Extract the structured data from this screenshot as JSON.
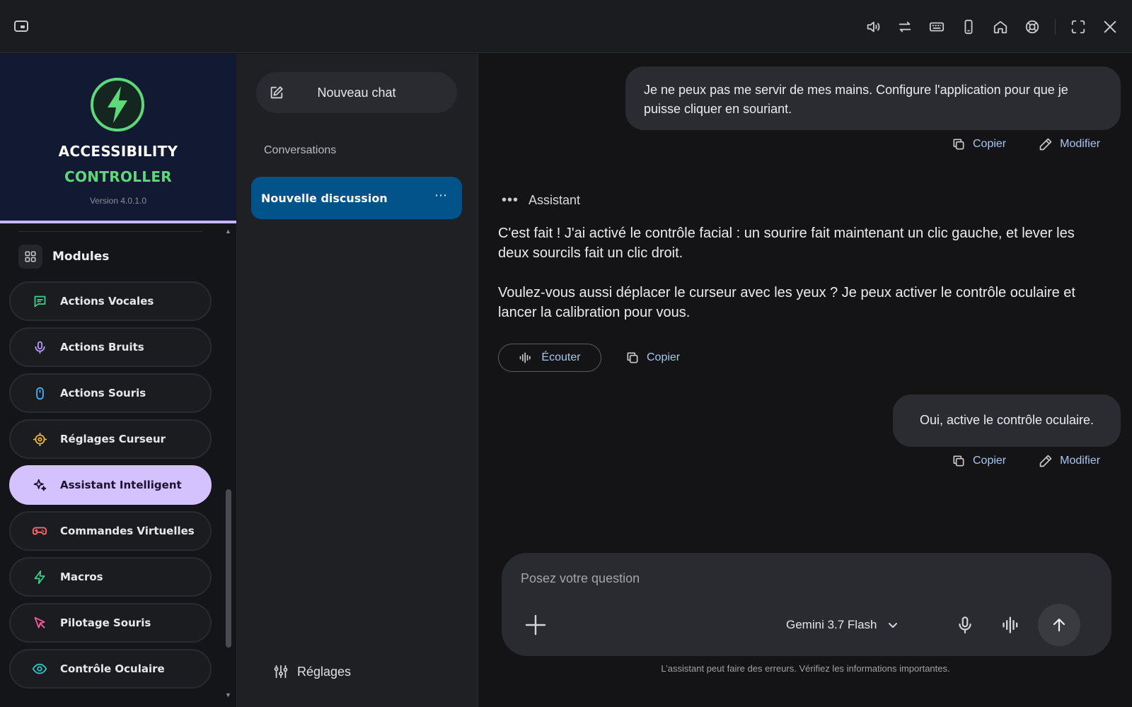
{
  "brand": {
    "line1": "ACCESSIBILITY",
    "line2": "CONTROLLER",
    "version": "Version 4.0.1.0",
    "accent": "#5fd87a"
  },
  "sidebar": {
    "section_title": "Modules",
    "items": [
      {
        "label": "Actions Vocales",
        "icon": "chat-icon",
        "color": "#3fd08a"
      },
      {
        "label": "Actions Bruits",
        "icon": "microphone-icon",
        "color": "#b99cff"
      },
      {
        "label": "Actions Souris",
        "icon": "mouse-icon",
        "color": "#4fb3ff"
      },
      {
        "label": "Réglages Curseur",
        "icon": "crosshair-icon",
        "color": "#f2b63a"
      },
      {
        "label": "Assistant Intelligent",
        "icon": "sparkle-icon",
        "color": "#1a1230"
      },
      {
        "label": "Commandes Virtuelles",
        "icon": "gamepad-icon",
        "color": "#ff6b6b"
      },
      {
        "label": "Macros",
        "icon": "lightning-icon",
        "color": "#3fd08a"
      },
      {
        "label": "Pilotage Souris",
        "icon": "cursor-pointer-icon",
        "color": "#ff5ca8"
      },
      {
        "label": "Contrôle Oculaire",
        "icon": "eye-icon",
        "color": "#2ec7c7"
      }
    ],
    "active_index": 4
  },
  "conversations": {
    "new_chat_label": "Nouveau chat",
    "section_title": "Conversations",
    "items": [
      {
        "label": "Nouvelle discussion",
        "more": "⋯"
      }
    ],
    "settings_label": "Réglages"
  },
  "chat": {
    "messages": [
      {
        "role": "user",
        "text": "Je ne peux pas me servir de mes mains. Configure l'application pour que je puisse cliquer en souriant.",
        "actions": [
          "Copier",
          "Modifier"
        ]
      },
      {
        "role": "assistant",
        "name": "Assistant",
        "paragraphs": [
          "C'est fait ! J'ai activé le contrôle facial : un sourire fait maintenant un clic gauche, et lever les deux sourcils fait un clic droit.",
          "Voulez-vous aussi déplacer le curseur avec les yeux ? Je peux activer le contrôle oculaire et lancer la calibration pour vous."
        ],
        "actions": [
          "Écouter",
          "Copier"
        ]
      },
      {
        "role": "user",
        "text": "Oui, active le contrôle oculaire.",
        "actions": [
          "Copier",
          "Modifier"
        ]
      }
    ],
    "composer": {
      "placeholder": "Posez votre question",
      "model": "Gemini 3.7 Flash"
    },
    "disclaimer": "L’assistant peut faire des erreurs. Vérifiez les informations importantes."
  }
}
